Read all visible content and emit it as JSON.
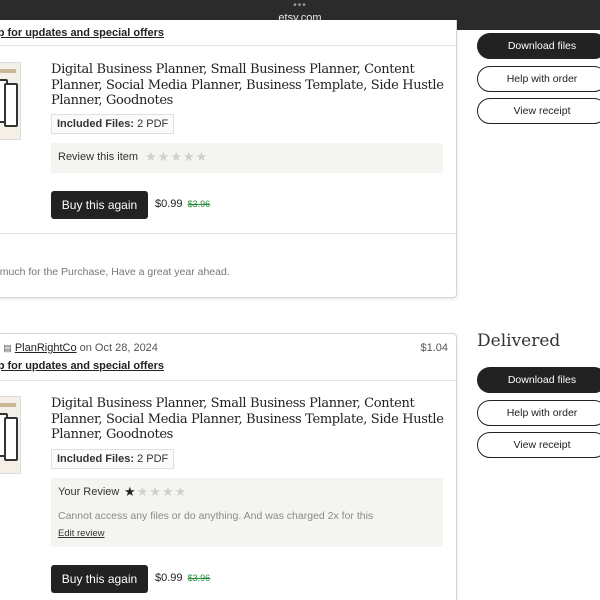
{
  "browser": {
    "url": "etsy.com"
  },
  "orders": [
    {
      "optin_text": "op for updates and special offers",
      "title": "Digital Business Planner, Small Business Planner, Content Planner, Social Media Planner, Business Template, Side Hustle Planner, Goodnotes",
      "files_label": "Included Files:",
      "files_value": "2 PDF",
      "review_label": "Review this item",
      "rating": 0,
      "buy_again": "Buy this again",
      "sale_price": "$0.99",
      "original_price": "$3.96",
      "seller_note": "o much for the Purchase, Have a great year ahead.",
      "actions": {
        "download": "Download files",
        "help": "Help with order",
        "receipt": "View receipt"
      }
    },
    {
      "shop_prefix": "m",
      "shop_name": "PlanRightCo",
      "date": "on Oct 28, 2024",
      "price": "$1.04",
      "status": "Delivered",
      "optin_text": "op for updates and special offers",
      "title": "Digital Business Planner, Small Business Planner, Content Planner, Social Media Planner, Business Template, Side Hustle Planner, Goodnotes",
      "files_label": "Included Files:",
      "files_value": "2 PDF",
      "review_label": "Your Review",
      "rating": 1,
      "review_text": "Cannot access any files or do anything. And was charged 2x for this",
      "edit_review": "Edit review",
      "buy_again": "Buy this again",
      "sale_price": "$0.99",
      "original_price": "$3.96",
      "actions": {
        "download": "Download files",
        "help": "Help with order",
        "receipt": "View receipt"
      }
    }
  ],
  "icons": {
    "shop": "shop-icon",
    "star_filled": "star-icon",
    "star_empty": "star-outline-icon",
    "more": "more-dots-icon"
  },
  "colors": {
    "dark": "#222222",
    "sale_green": "#2d8a3e",
    "review_bg": "#f4f4f1",
    "browser_bar": "#2b2b2b"
  }
}
